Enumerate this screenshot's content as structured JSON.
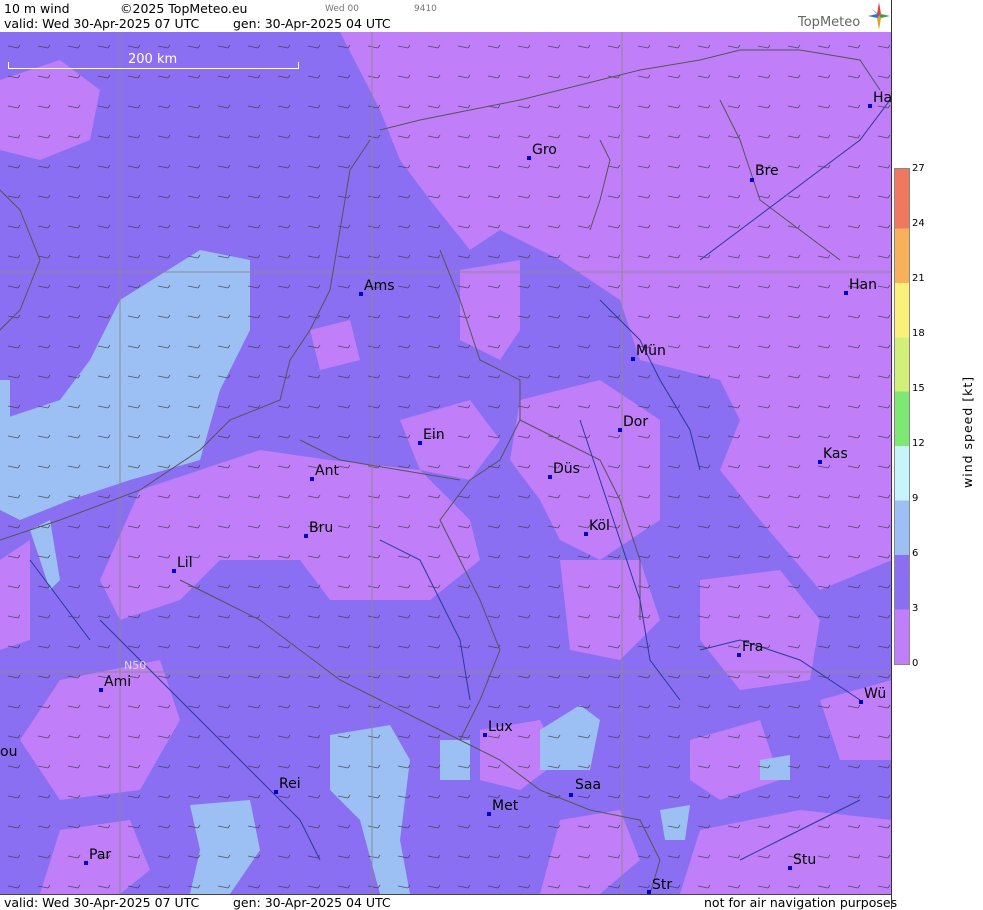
{
  "header": {
    "product": "10 m wind",
    "copyright": "©2025 TopMeteo.eu",
    "small_time": "Wed 00",
    "small_code": "9410",
    "valid": "valid:  Wed  30-Apr-2025  07 UTC",
    "gen": "gen: 30-Apr-2025 04 UTC",
    "logo": "TopMeteo"
  },
  "footer": {
    "valid": "valid:  Wed  30-Apr-2025  07 UTC",
    "gen": "gen: 30-Apr-2025 04 UTC",
    "note": "not for air navigation purposes"
  },
  "scale": {
    "label": "200 km"
  },
  "grid_label": "N50",
  "legend": {
    "title": "wind  speed  [kt]",
    "ticks": [
      "27",
      "24",
      "21",
      "18",
      "15",
      "12",
      "9",
      "6",
      "3",
      "0"
    ],
    "colors": [
      "#f07860",
      "#f9b05a",
      "#fbf07a",
      "#d2ef7a",
      "#7ee874",
      "#c7f4fa",
      "#9cc0f4",
      "#8a6ff2",
      "#c07ef8"
    ]
  },
  "cities": [
    {
      "id": "ha",
      "name": "Ha"
    },
    {
      "id": "gro",
      "name": "Gro"
    },
    {
      "id": "bre",
      "name": "Bre"
    },
    {
      "id": "ams",
      "name": "Ams"
    },
    {
      "id": "han",
      "name": "Han"
    },
    {
      "id": "mun",
      "name": "Mün"
    },
    {
      "id": "dor",
      "name": "Dor"
    },
    {
      "id": "ein",
      "name": "Ein"
    },
    {
      "id": "kas",
      "name": "Kas"
    },
    {
      "id": "ant",
      "name": "Ant"
    },
    {
      "id": "dus",
      "name": "Düs"
    },
    {
      "id": "kol",
      "name": "Köl"
    },
    {
      "id": "bru",
      "name": "Bru"
    },
    {
      "id": "lil",
      "name": "Lil"
    },
    {
      "id": "fra",
      "name": "Fra"
    },
    {
      "id": "ami",
      "name": "Ami"
    },
    {
      "id": "wu",
      "name": "Wü"
    },
    {
      "id": "lux",
      "name": "Lux"
    },
    {
      "id": "ou",
      "name": "ou"
    },
    {
      "id": "rei",
      "name": "Rei"
    },
    {
      "id": "saa",
      "name": "Saa"
    },
    {
      "id": "met",
      "name": "Met"
    },
    {
      "id": "par",
      "name": "Par"
    },
    {
      "id": "stu",
      "name": "Stu"
    },
    {
      "id": "str",
      "name": "Str"
    }
  ]
}
